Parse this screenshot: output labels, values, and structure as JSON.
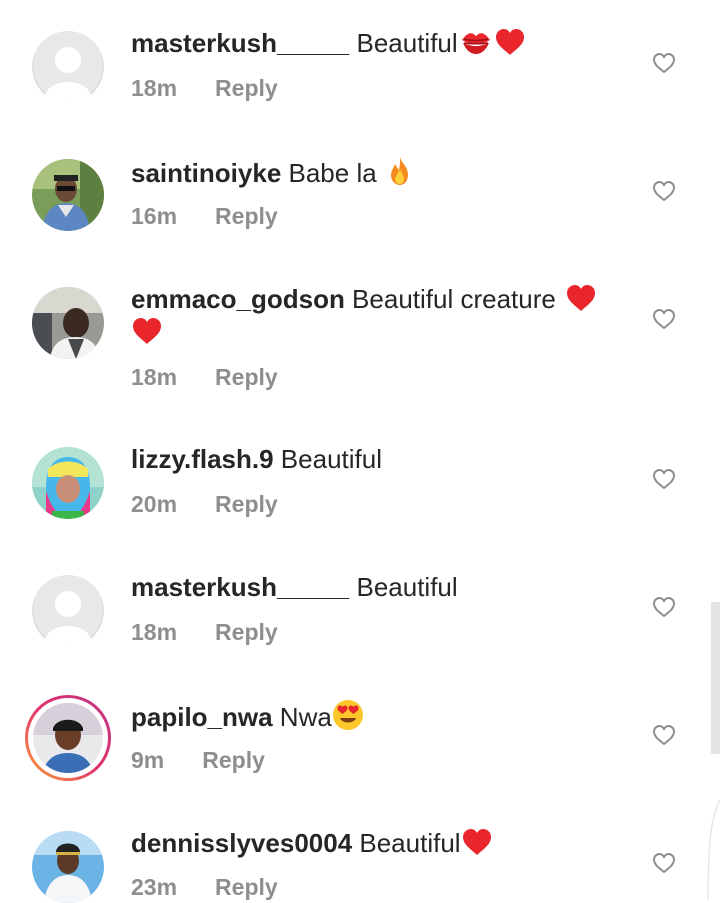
{
  "comments": [
    {
      "username": "masterkush_____",
      "text": " Beautiful",
      "emojis": [
        "kiss-mark-icon",
        "red-heart-icon"
      ],
      "time": "18m",
      "reply": "Reply",
      "avatar": "default-avatar"
    },
    {
      "username": "saintinoiyke",
      "text": " Babe la ",
      "emojis": [
        "fire-icon"
      ],
      "time": "16m",
      "reply": "Reply",
      "avatar": "photo-avatar"
    },
    {
      "username": "emmaco_godson",
      "text": " Beautiful creature ",
      "emojis": [
        "red-heart-icon",
        "red-heart-icon"
      ],
      "time": "18m",
      "reply": "Reply",
      "avatar": "photo-avatar"
    },
    {
      "username": "lizzy.flash.9",
      "text": " Beautiful",
      "emojis": [],
      "time": "20m",
      "reply": "Reply",
      "avatar": "photo-avatar"
    },
    {
      "username": "masterkush_____",
      "text": " Beautiful",
      "emojis": [],
      "time": "18m",
      "reply": "Reply",
      "avatar": "default-avatar"
    },
    {
      "username": "papilo_nwa",
      "text": " Nwa",
      "emojis": [
        "heart-eyes-icon"
      ],
      "time": "9m",
      "reply": "Reply",
      "avatar": "story-ring-avatar"
    },
    {
      "username": "dennisslyves0004",
      "text": " Beautiful",
      "emojis": [
        "red-heart-icon"
      ],
      "time": "23m",
      "reply": "Reply",
      "avatar": "photo-avatar"
    }
  ],
  "colors": {
    "username": "#262626",
    "meta": "#8e8e8e",
    "heart": "#e8262b",
    "story_ring": "#e1306c"
  },
  "icons": {
    "like": "heart-outline-icon"
  }
}
